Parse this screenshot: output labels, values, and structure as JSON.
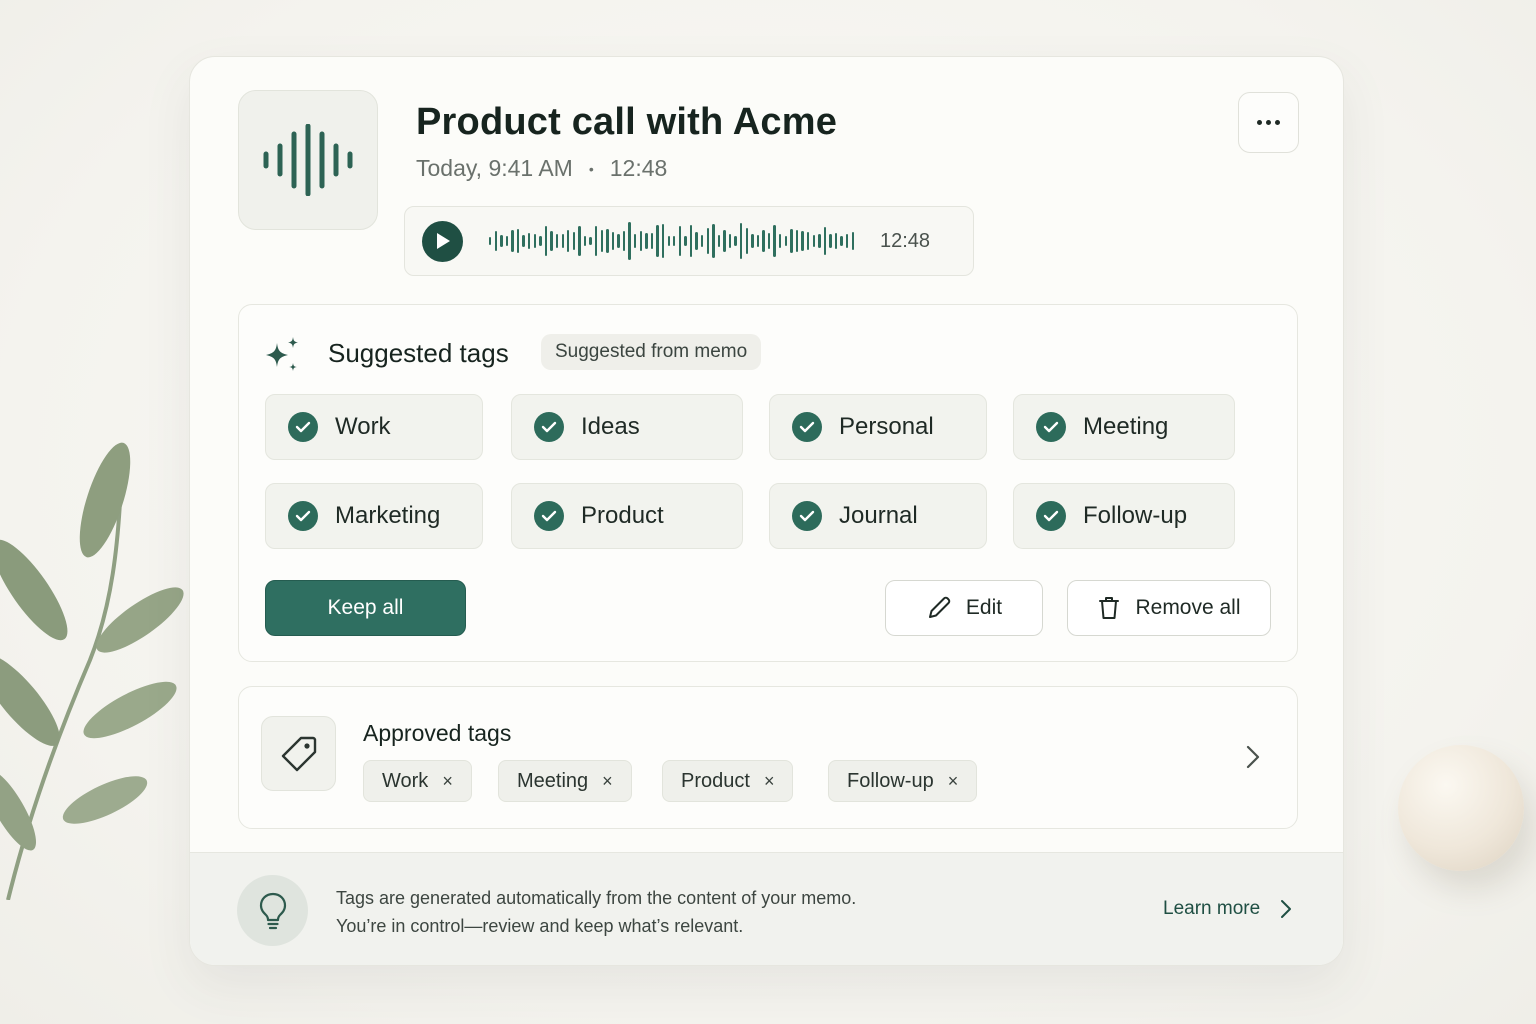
{
  "memo": {
    "title": "Product call with Acme",
    "date": "Today, 9:41 AM",
    "separator": "•",
    "duration": "12:48",
    "player_time": "12:48"
  },
  "header": {
    "more_icon": "more-horizontal-icon"
  },
  "suggested": {
    "title": "Suggested tags",
    "badge": "Suggested from memo",
    "tags": [
      "Work",
      "Ideas",
      "Personal",
      "Meeting",
      "Marketing",
      "Product",
      "Journal",
      "Follow-up"
    ],
    "keep_all": "Keep all",
    "edit": "Edit",
    "remove_all": "Remove all"
  },
  "approved": {
    "title": "Approved tags",
    "tags": [
      "Work",
      "Meeting",
      "Product",
      "Follow-up"
    ],
    "remove_symbol": "×"
  },
  "footer": {
    "line1": "Tags are generated automatically from the content of your memo.",
    "line2": "You’re in control—review and keep what’s relevant.",
    "learn_more": "Learn more"
  },
  "colors": {
    "accent": "#2f6f61",
    "accent_dark": "#1f4f43",
    "check": "#2d6b5b",
    "background": "#f6f5f0"
  }
}
